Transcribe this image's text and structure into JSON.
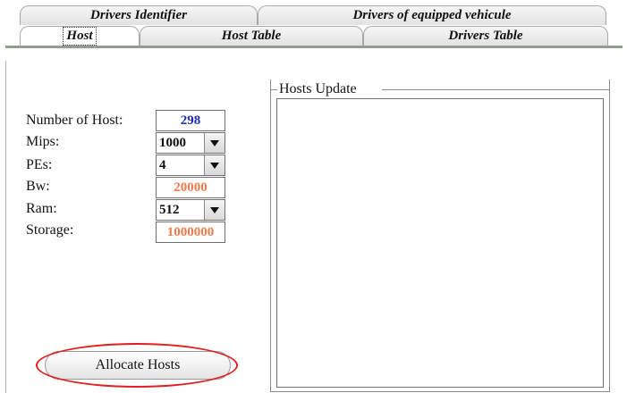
{
  "tabs_row1": [
    {
      "label": "Drivers Identifier"
    },
    {
      "label": "Drivers  of equipped vehicule"
    }
  ],
  "tabs_row2": [
    {
      "label": "Host",
      "selected": true
    },
    {
      "label": "Host Table"
    },
    {
      "label": "Drivers Table"
    }
  ],
  "form": {
    "number_of_host": {
      "label": "Number of Host:",
      "value": "298",
      "color": "#1d2cb8"
    },
    "mips": {
      "label": "Mips:",
      "value": "1000"
    },
    "pes": {
      "label": "PEs:",
      "value": "4"
    },
    "bw": {
      "label": "Bw:",
      "value": "20000",
      "color": "#f07a4a"
    },
    "ram": {
      "label": "Ram:",
      "value": "512"
    },
    "storage": {
      "label": "Storage:",
      "value": "1000000",
      "color": "#f07a4a"
    }
  },
  "hosts_update": {
    "title": "Hosts Update",
    "items": []
  },
  "allocate_button": {
    "label": "Allocate Hosts"
  },
  "colors": {
    "highlight": "#e02020",
    "band": "#8fa08d"
  }
}
